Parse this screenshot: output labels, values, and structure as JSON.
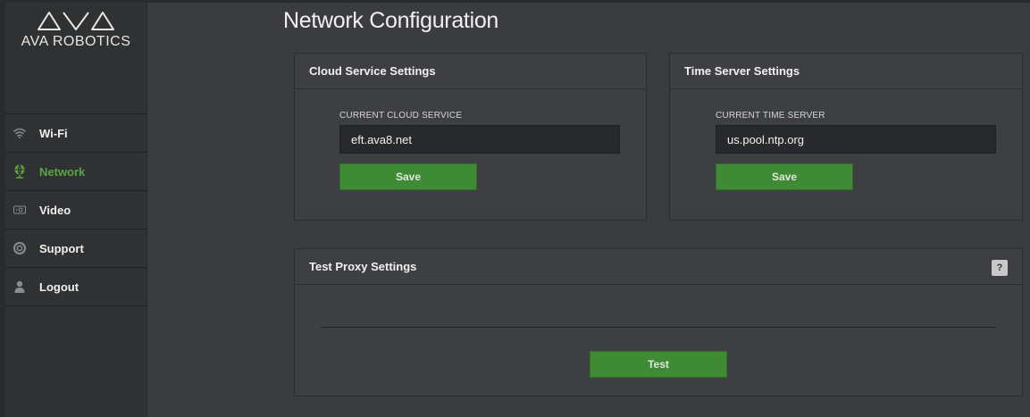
{
  "brand": {
    "name": "AVA ROBOTICS"
  },
  "sidebar": {
    "items": [
      {
        "label": "Wi-Fi",
        "icon": "wifi-icon",
        "active": false
      },
      {
        "label": "Network",
        "icon": "globe-icon",
        "active": true
      },
      {
        "label": "Video",
        "icon": "video-icon",
        "active": false
      },
      {
        "label": "Support",
        "icon": "lifebuoy-icon",
        "active": false
      },
      {
        "label": "Logout",
        "icon": "user-icon",
        "active": false
      }
    ]
  },
  "page": {
    "title": "Network Configuration"
  },
  "cloud": {
    "title": "Cloud Service Settings",
    "field_label": "CURRENT CLOUD SERVICE",
    "value": "eft.ava8.net",
    "save_label": "Save"
  },
  "time": {
    "title": "Time Server Settings",
    "field_label": "CURRENT TIME SERVER",
    "value": "us.pool.ntp.org",
    "save_label": "Save"
  },
  "proxy": {
    "title": "Test Proxy Settings",
    "help_label": "?",
    "test_label": "Test"
  },
  "colors": {
    "accent": "#5aa642",
    "button": "#3f8a35",
    "background": "#3a3c3f",
    "sidebar": "#2f3133"
  }
}
